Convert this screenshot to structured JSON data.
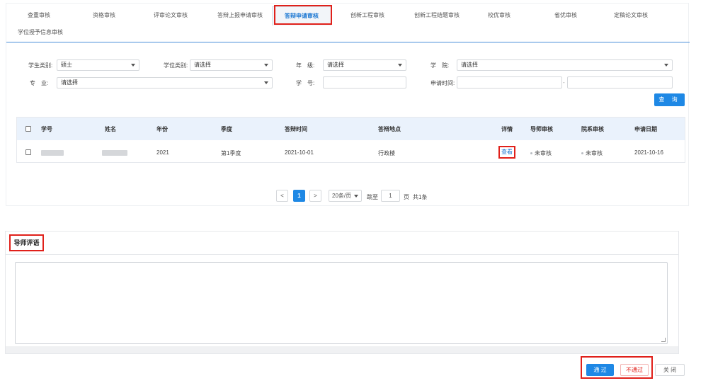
{
  "tabs": [
    {
      "label": "查重审核"
    },
    {
      "label": "资格审核"
    },
    {
      "label": "评审论文审核"
    },
    {
      "label": "答辩上报申请审核"
    },
    {
      "label": "答辩申请审核"
    },
    {
      "label": "创新工程审核"
    },
    {
      "label": "创新工程结题审核"
    },
    {
      "label": "校优审核"
    },
    {
      "label": "省优审核"
    },
    {
      "label": "定稿论文审核"
    },
    {
      "label": "学位授予信息审核"
    }
  ],
  "active_tab_index": 4,
  "filters": {
    "student_type_label": "学生类别:",
    "student_type_value": "硕士",
    "degree_type_label": "学位类别:",
    "degree_type_value": "请选择",
    "grade_label": "年　级:",
    "grade_value": "请选择",
    "college_label": "学　院:",
    "college_value": "请选择",
    "major_label": "专　业:",
    "major_value": "请选择",
    "student_id_label": "学　号:",
    "student_id_value": "",
    "apply_time_label": "申请时间:",
    "apply_time_separator": "-",
    "query_button": "查 询"
  },
  "table": {
    "headers": {
      "student_id": "学号",
      "name": "姓名",
      "year": "年份",
      "season": "季度",
      "defense_time": "答辩时间",
      "defense_place": "答辩地点",
      "detail": "详情",
      "tutor_review": "导师审核",
      "dept_review": "院系审核",
      "apply_date": "申请日期"
    },
    "rows": [
      {
        "year": "2021",
        "season": "第1季度",
        "defense_time": "2021-10-01",
        "defense_place": "行政楼",
        "detail": "查看",
        "tutor_review": "未审核",
        "dept_review": "未审核",
        "apply_date": "2021-10-16"
      }
    ]
  },
  "pagination": {
    "prev": "<",
    "current_page": "1",
    "next": ">",
    "page_size": "20条/页",
    "goto_label": "跳至",
    "goto_value": "1",
    "page_suffix": "页",
    "total": "共1条"
  },
  "comment": {
    "title": "导师评语",
    "value": ""
  },
  "actions": {
    "pass": "通 过",
    "fail": "不通过",
    "close": "关 闭"
  },
  "colors": {
    "primary": "#1e88e5",
    "highlight": "#e0201a",
    "table_header": "#eaf2fc"
  }
}
